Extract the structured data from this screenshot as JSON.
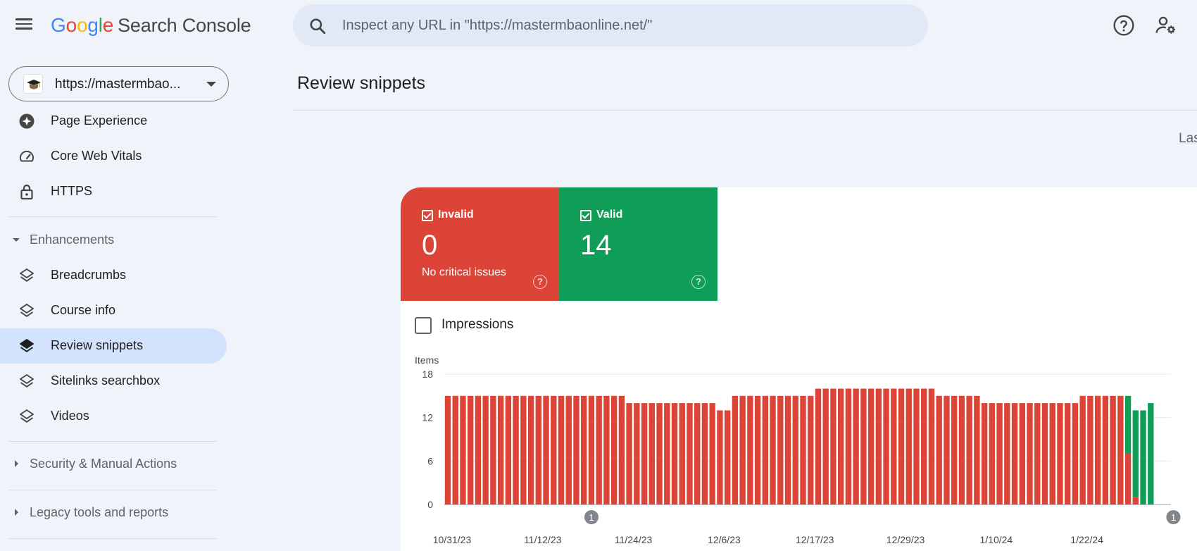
{
  "header": {
    "logo_letters": [
      "G",
      "o",
      "o",
      "g",
      "l",
      "e"
    ],
    "product": "Search Console",
    "search_placeholder": "Inspect any URL in \"https://mastermbaonline.net/\""
  },
  "property": {
    "label": "https://mastermbao..."
  },
  "sidebar": {
    "items_top": [
      {
        "label": "Page Experience",
        "icon": "page-experience-icon"
      },
      {
        "label": "Core Web Vitals",
        "icon": "speedometer-icon"
      },
      {
        "label": "HTTPS",
        "icon": "lock-icon"
      }
    ],
    "enhancements": {
      "label": "Enhancements",
      "items": [
        {
          "label": "Breadcrumbs",
          "icon": "layers-icon",
          "active": false
        },
        {
          "label": "Course info",
          "icon": "layers-icon",
          "active": false
        },
        {
          "label": "Review snippets",
          "icon": "layers-icon",
          "active": true
        },
        {
          "label": "Sitelinks searchbox",
          "icon": "layers-icon",
          "active": false
        },
        {
          "label": "Videos",
          "icon": "layers-icon",
          "active": false
        }
      ]
    },
    "security": {
      "label": "Security & Manual Actions"
    },
    "legacy": {
      "label": "Legacy tools and reports"
    }
  },
  "main": {
    "title": "Review snippets",
    "last_label": "Las",
    "tiles": {
      "invalid": {
        "label": "Invalid",
        "value": "0",
        "sub": "No critical issues"
      },
      "valid": {
        "label": "Valid",
        "value": "14"
      }
    },
    "impressions_label": "Impressions"
  },
  "colors": {
    "invalid": "#db4437",
    "valid": "#0f9d58",
    "active_nav": "#d3e3fd"
  },
  "chart_data": {
    "type": "bar",
    "stacked": true,
    "ylabel": "Items",
    "ylim": [
      0,
      18
    ],
    "yticks": [
      0,
      6,
      12,
      18
    ],
    "xtick_labels": [
      "10/31/23",
      "11/12/23",
      "11/24/23",
      "12/6/23",
      "12/17/23",
      "12/29/23",
      "1/10/24",
      "1/22/24"
    ],
    "xtick_start_index": 0,
    "xtick_step": 12,
    "annotations": [
      {
        "index": 19,
        "label": "1"
      },
      {
        "index": 96,
        "label": "1"
      }
    ],
    "series": [
      {
        "name": "Invalid",
        "color": "#db4437",
        "values": [
          15,
          15,
          15,
          15,
          15,
          15,
          15,
          15,
          15,
          15,
          15,
          15,
          15,
          15,
          15,
          15,
          15,
          15,
          15,
          15,
          15,
          15,
          15,
          15,
          14,
          14,
          14,
          14,
          14,
          14,
          14,
          14,
          14,
          14,
          14,
          14,
          13,
          13,
          15,
          15,
          15,
          15,
          15,
          15,
          15,
          15,
          15,
          15,
          15,
          16,
          16,
          16,
          16,
          16,
          16,
          16,
          16,
          16,
          16,
          16,
          16,
          16,
          16,
          16,
          16,
          15,
          15,
          15,
          15,
          15,
          15,
          14,
          14,
          14,
          14,
          14,
          14,
          14,
          14,
          14,
          14,
          14,
          14,
          14,
          15,
          15,
          15,
          15,
          15,
          15,
          7,
          1,
          0,
          0,
          0
        ]
      },
      {
        "name": "Valid",
        "color": "#0f9d58",
        "values": [
          0,
          0,
          0,
          0,
          0,
          0,
          0,
          0,
          0,
          0,
          0,
          0,
          0,
          0,
          0,
          0,
          0,
          0,
          0,
          0,
          0,
          0,
          0,
          0,
          0,
          0,
          0,
          0,
          0,
          0,
          0,
          0,
          0,
          0,
          0,
          0,
          0,
          0,
          0,
          0,
          0,
          0,
          0,
          0,
          0,
          0,
          0,
          0,
          0,
          0,
          0,
          0,
          0,
          0,
          0,
          0,
          0,
          0,
          0,
          0,
          0,
          0,
          0,
          0,
          0,
          0,
          0,
          0,
          0,
          0,
          0,
          0,
          0,
          0,
          0,
          0,
          0,
          0,
          0,
          0,
          0,
          0,
          0,
          0,
          0,
          0,
          0,
          0,
          0,
          0,
          8,
          12,
          13,
          14,
          0
        ]
      }
    ]
  }
}
